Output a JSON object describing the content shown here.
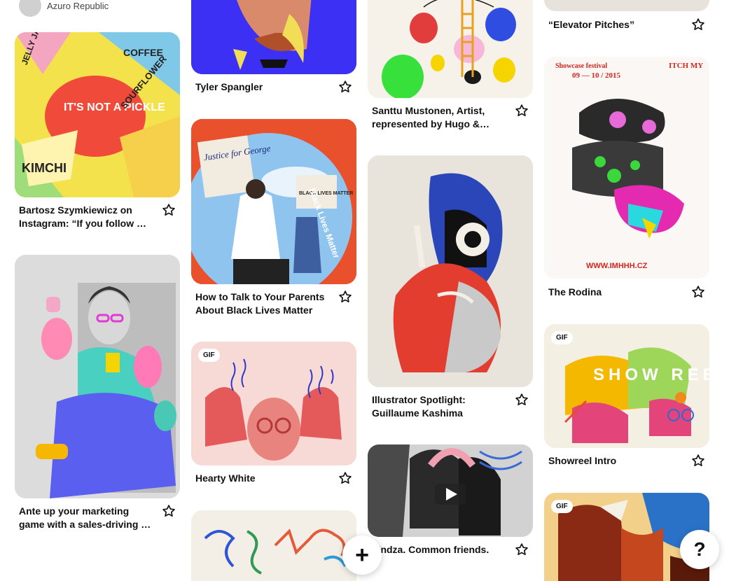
{
  "owner": {
    "name": "Azuro Republic"
  },
  "gif_label": "GIF",
  "pins": [
    {
      "title": "Bartosz Szymkiewicz on Instagram: “If you follow …"
    },
    {
      "title": "Ante up your marketing game with a sales-driving …"
    },
    {
      "title": "Tyler Spangler"
    },
    {
      "title": "How to Talk to Your Parents About Black Lives Matter"
    },
    {
      "title": "Hearty White"
    },
    {
      "title": "Santtu Mustonen, Artist, represented by Hugo &…"
    },
    {
      "title": "Illustrator Spotlight: Guillaume Kashima"
    },
    {
      "title": "Lindza. Common friends."
    },
    {
      "title": "“Elevator Pitches”"
    },
    {
      "title": "The Rodina"
    },
    {
      "title": "Showreel Intro"
    }
  ],
  "image_text": {
    "pickle_headline": "IT'S NOT A PICKLE",
    "kimchi": "KIMCHI",
    "sourflower": "SOURFLOWER",
    "coffee": "COFFEE",
    "jelly_jasmine": "JELLY JASMINE",
    "justice_sign": "Justice for George",
    "blm_sign": "BLACK LIVES MATTER",
    "blm_ring": "Black Lives Matter",
    "showcase_heading": "Showcase festival",
    "showcase_dates": "09 — 10 / 2015",
    "itch_my": "ITCH MY",
    "site_url": "WWW.IMHHH.CZ",
    "showreel_letters": "SHOW REEL"
  },
  "controls": {
    "add": "+",
    "help": "?"
  }
}
